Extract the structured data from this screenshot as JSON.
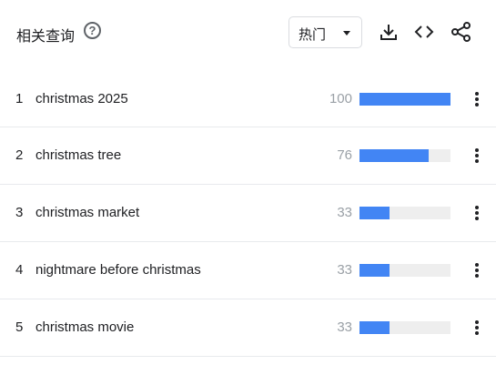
{
  "header": {
    "title": "相关查询",
    "help_icon": "?",
    "sort_label": "热门"
  },
  "rows": [
    {
      "rank": "1",
      "query": "christmas 2025",
      "value": "100",
      "bar_percent": 100
    },
    {
      "rank": "2",
      "query": "christmas tree",
      "value": "76",
      "bar_percent": 76
    },
    {
      "rank": "3",
      "query": "christmas market",
      "value": "33",
      "bar_percent": 33
    },
    {
      "rank": "4",
      "query": "nightmare before christmas",
      "value": "33",
      "bar_percent": 33
    },
    {
      "rank": "5",
      "query": "christmas movie",
      "value": "33",
      "bar_percent": 33
    }
  ],
  "colors": {
    "bar_fill": "#4285f4",
    "bar_track": "#eeeeee",
    "value_text": "#9aa0a6"
  }
}
